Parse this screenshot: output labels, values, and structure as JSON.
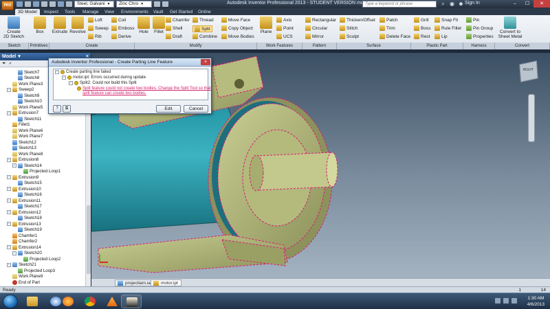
{
  "titlebar": {
    "app_button": "PRO",
    "material": "Steel, Galvani",
    "appearance": "Zinc Chro",
    "title": "Autodesk Inventor Professional 2013 - STUDENT VERSION    motor",
    "search_placeholder": "Type a keyword or phrase",
    "signin": "Sign In"
  },
  "tabs": [
    "3D Model",
    "Inspect",
    "Tools",
    "Manage",
    "View",
    "Environments",
    "Vault",
    "Get Started",
    "Online"
  ],
  "ribbon": {
    "panels": [
      "Sketch",
      "Primitives",
      "Create",
      "Modify",
      "Work Features",
      "Pattern",
      "Surface",
      "Plastic Part",
      "Harness",
      "Convert"
    ],
    "create_sketch": "Create\n2D Sketch",
    "box": "Box",
    "extrude": "Extrude",
    "revolve": "Revolve",
    "loft": "Loft",
    "sweep": "Sweep",
    "rib": "Rib",
    "coil": "Coil",
    "emboss": "Emboss",
    "derive": "Derive",
    "hole": "Hole",
    "fillet": "Fillet",
    "chamfer": "Chamfer",
    "shell": "Shell",
    "draft": "Draft",
    "thread": "Thread",
    "split": "Split",
    "combine": "Combine",
    "move_face": "Move Face",
    "copy_object": "Copy Object",
    "move_bodies": "Move Bodies",
    "plane": "Plane",
    "axis": "Axis",
    "point": "Point",
    "ucs": "UCS",
    "rectangular": "Rectangular",
    "circular": "Circular",
    "mirror": "Mirror",
    "thicken": "Thicken/Offset",
    "stitch": "Stitch",
    "sculpt": "Sculpt",
    "patch": "Patch",
    "trim": "Trim",
    "delete_face": "Delete Face",
    "grill": "Grill",
    "boss": "Boss",
    "rest": "Rest",
    "snap_fit": "Snap Fit",
    "rule_fillet": "Rule Fillet",
    "lip": "Lip",
    "pin": "Pin",
    "pin_group": "Pin Group",
    "properties": "Properties",
    "convert_sheet": "Convert to\nSheet Metal"
  },
  "browser": {
    "title": "Model",
    "close": "×",
    "nodes": [
      {
        "label": "Sketch7",
        "type": "sk",
        "indent": 2
      },
      {
        "label": "Sketch8",
        "type": "sk",
        "indent": 2
      },
      {
        "label": "Work Plane3",
        "type": "wp",
        "indent": 1
      },
      {
        "label": "Sweep2",
        "type": "ex",
        "indent": 1,
        "exp": true
      },
      {
        "label": "Sketch9",
        "type": "sk",
        "indent": 2
      },
      {
        "label": "Sketch10",
        "type": "sk",
        "indent": 2
      },
      {
        "label": "Work Plane5",
        "type": "wp",
        "indent": 1
      },
      {
        "label": "Extrusion7",
        "type": "ex",
        "indent": 1,
        "exp": true
      },
      {
        "label": "Sketch11",
        "type": "sk",
        "indent": 2
      },
      {
        "label": "Fillet1",
        "type": "ex",
        "indent": 1
      },
      {
        "label": "Work Plane6",
        "type": "wp",
        "indent": 1
      },
      {
        "label": "Work Plane7",
        "type": "wp",
        "indent": 1
      },
      {
        "label": "Sketch12",
        "type": "sk",
        "indent": 1
      },
      {
        "label": "Sketch13",
        "type": "sk",
        "indent": 1
      },
      {
        "label": "Work Plane8",
        "type": "wp",
        "indent": 1
      },
      {
        "label": "Extrusion8",
        "type": "ex",
        "indent": 1,
        "exp": true
      },
      {
        "label": "Sketch14",
        "type": "sk",
        "indent": 2,
        "exp": true
      },
      {
        "label": "Projected Loop1",
        "type": "pl",
        "indent": 3
      },
      {
        "label": "Extrusion9",
        "type": "ex",
        "indent": 1,
        "exp": true
      },
      {
        "label": "Sketch15",
        "type": "sk",
        "indent": 2
      },
      {
        "label": "Extrusion10",
        "type": "ex",
        "indent": 1,
        "exp": true
      },
      {
        "label": "Sketch16",
        "type": "sk",
        "indent": 2
      },
      {
        "label": "Extrusion11",
        "type": "ex",
        "indent": 1,
        "exp": true
      },
      {
        "label": "Sketch17",
        "type": "sk",
        "indent": 2
      },
      {
        "label": "Extrusion12",
        "type": "ex",
        "indent": 1,
        "exp": true
      },
      {
        "label": "Sketch18",
        "type": "sk",
        "indent": 2
      },
      {
        "label": "Extrusion13",
        "type": "ex",
        "indent": 1,
        "exp": true
      },
      {
        "label": "Sketch19",
        "type": "sk",
        "indent": 2
      },
      {
        "label": "Chamfer1",
        "type": "ch",
        "indent": 1
      },
      {
        "label": "Chamfer2",
        "type": "ch",
        "indent": 1
      },
      {
        "label": "Extrusion14",
        "type": "ex",
        "indent": 1,
        "exp": true
      },
      {
        "label": "Sketch20",
        "type": "sk",
        "indent": 2,
        "exp": true
      },
      {
        "label": "Projected Loop2",
        "type": "pl",
        "indent": 3
      },
      {
        "label": "Sketch21",
        "type": "sk",
        "indent": 1,
        "exp": true
      },
      {
        "label": "Projected Loop3",
        "type": "pl",
        "indent": 2
      },
      {
        "label": "Work Plane9",
        "type": "wp",
        "indent": 1
      },
      {
        "label": "End of Part",
        "type": "end",
        "indent": 1
      }
    ]
  },
  "dialog": {
    "title": "Autodesk Inventor Professional - Create Parting Line Feature",
    "close": "×",
    "line1": "Create parting line failed",
    "line2": "motor.ipt: Errors occurred during update",
    "line3": "Split2: Could not build this Split",
    "line4": "Split feature could not create two bodies. Change the Split Tool so that split feature can create two bodies.",
    "edit": "Edit",
    "cancel": "Cancel"
  },
  "doctabs": [
    "projectiam.iam",
    "motor.ipt"
  ],
  "status": {
    "left": "Ready",
    "right_1": "1",
    "right_2": "14"
  },
  "taskbar": {
    "time": "1:30 AM",
    "date": "4/6/2013"
  }
}
